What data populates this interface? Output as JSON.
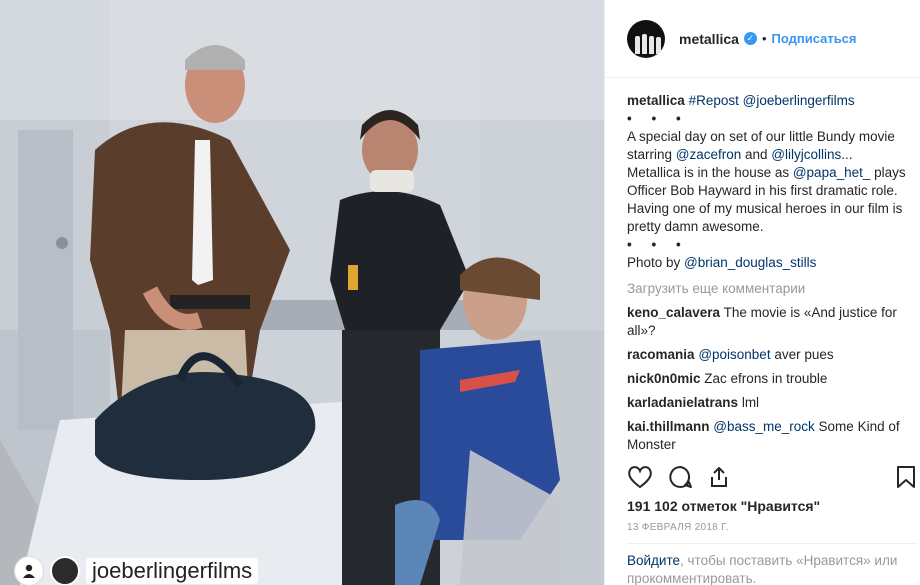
{
  "photo": {
    "overlay_handle": "joeberlingerfilms",
    "description_icons": [
      "person-icon",
      "avatar"
    ]
  },
  "header": {
    "username": "metallica",
    "verified_mark": "✓",
    "separator": "•",
    "follow_label": "Подписаться"
  },
  "caption": {
    "user": "metallica",
    "repost_tag": "#Repost",
    "repost_mention": "@joeberlingerfilms",
    "bullets": "• • •",
    "line1a": "A special day on set of our little Bundy movie starring ",
    "mention_zac": "@zacefron",
    "and": " and ",
    "mention_lily": "@lilyjcollins",
    "line1b": "... Metallica is in the house as ",
    "mention_papa": "@papa_het_",
    "line1c": " plays Officer Bob Hayward in his first dramatic role. Having one of my musical heroes in our film is pretty damn awesome.",
    "bullets2": "• • •",
    "photo_by": "Photo by ",
    "mention_brian": "@brian_douglas_stills"
  },
  "load_more": "Загрузить еще комментарии",
  "comments": [
    {
      "user": "keno_calavera",
      "text": " The movie is «And justice for all»?"
    },
    {
      "user": "racomania",
      "mention": "@poisonbet",
      "text": " aver pues"
    },
    {
      "user": "nick0n0mic",
      "text": " Zac efrons in trouble"
    },
    {
      "user": "karladanielatrans",
      "text": " lml"
    },
    {
      "user": "kai.thillmann",
      "mention": "@bass_me_rock",
      "text": " Some Kind of Monster"
    }
  ],
  "actions": {
    "icons": [
      "heart-icon",
      "comment-icon",
      "share-icon",
      "bookmark-icon"
    ]
  },
  "likes": "191 102 отметок \"Нравится\"",
  "date": "13 ФЕВРАЛЯ 2018 Г.",
  "login": {
    "link": "Войдите",
    "rest": ", чтобы поставить «Нравится» или прокомментировать."
  },
  "colors": {
    "accent": "#3897f0",
    "link": "#003569",
    "muted": "#999999",
    "text": "#262626"
  }
}
